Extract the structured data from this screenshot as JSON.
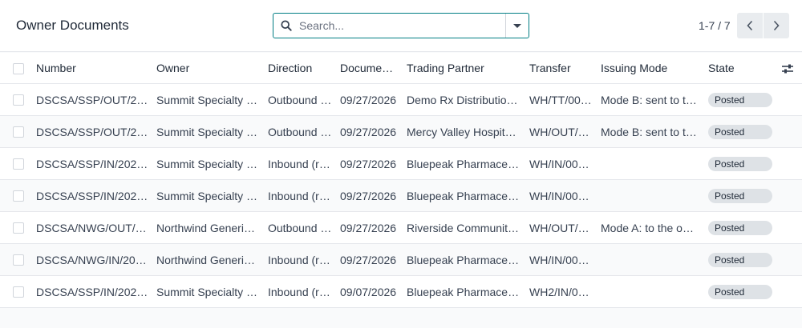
{
  "page": {
    "title": "Owner Documents"
  },
  "search": {
    "placeholder": "Search..."
  },
  "pager": {
    "value": "1-7 / 7"
  },
  "icons": {
    "search": "search-icon",
    "dropdown": "caret-down-icon",
    "prev": "chevron-left-icon",
    "next": "chevron-right-icon",
    "columns": "sliders-icon"
  },
  "colors": {
    "accent": "#017e84",
    "badge": "#dee2e6"
  },
  "table": {
    "columns": {
      "number": "Number",
      "owner": "Owner",
      "direction": "Direction",
      "date": "Docume…",
      "partner": "Trading Partner",
      "transfer": "Transfer",
      "mode": "Issuing Mode",
      "state": "State"
    },
    "rows": [
      {
        "number": "DSCSA/SSP/OUT/2…",
        "owner": "Summit Specialty …",
        "direction": "Outbound …",
        "date": "09/27/2026",
        "partner": "Demo Rx Distributio…",
        "transfer": "WH/TT/00…",
        "mode": "Mode B: sent to t…",
        "state": "Posted"
      },
      {
        "number": "DSCSA/SSP/OUT/2…",
        "owner": "Summit Specialty …",
        "direction": "Outbound …",
        "date": "09/27/2026",
        "partner": "Mercy Valley Hospit…",
        "transfer": "WH/OUT/…",
        "mode": "Mode B: sent to t…",
        "state": "Posted"
      },
      {
        "number": "DSCSA/SSP/IN/202…",
        "owner": "Summit Specialty …",
        "direction": "Inbound (r…",
        "date": "09/27/2026",
        "partner": "Bluepeak Pharmace…",
        "transfer": "WH/IN/00…",
        "mode": "",
        "state": "Posted"
      },
      {
        "number": "DSCSA/SSP/IN/202…",
        "owner": "Summit Specialty …",
        "direction": "Inbound (r…",
        "date": "09/27/2026",
        "partner": "Bluepeak Pharmace…",
        "transfer": "WH/IN/00…",
        "mode": "",
        "state": "Posted"
      },
      {
        "number": "DSCSA/NWG/OUT/…",
        "owner": "Northwind Generic…",
        "direction": "Outbound …",
        "date": "09/27/2026",
        "partner": "Riverside Communit…",
        "transfer": "WH/OUT/…",
        "mode": "Mode A: to the o…",
        "state": "Posted"
      },
      {
        "number": "DSCSA/NWG/IN/20…",
        "owner": "Northwind Generic…",
        "direction": "Inbound (r…",
        "date": "09/27/2026",
        "partner": "Bluepeak Pharmace…",
        "transfer": "WH/IN/00…",
        "mode": "",
        "state": "Posted"
      },
      {
        "number": "DSCSA/SSP/IN/202…",
        "owner": "Summit Specialty …",
        "direction": "Inbound (r…",
        "date": "09/07/2026",
        "partner": "Bluepeak Pharmace…",
        "transfer": "WH2/IN/0…",
        "mode": "",
        "state": "Posted"
      }
    ]
  }
}
